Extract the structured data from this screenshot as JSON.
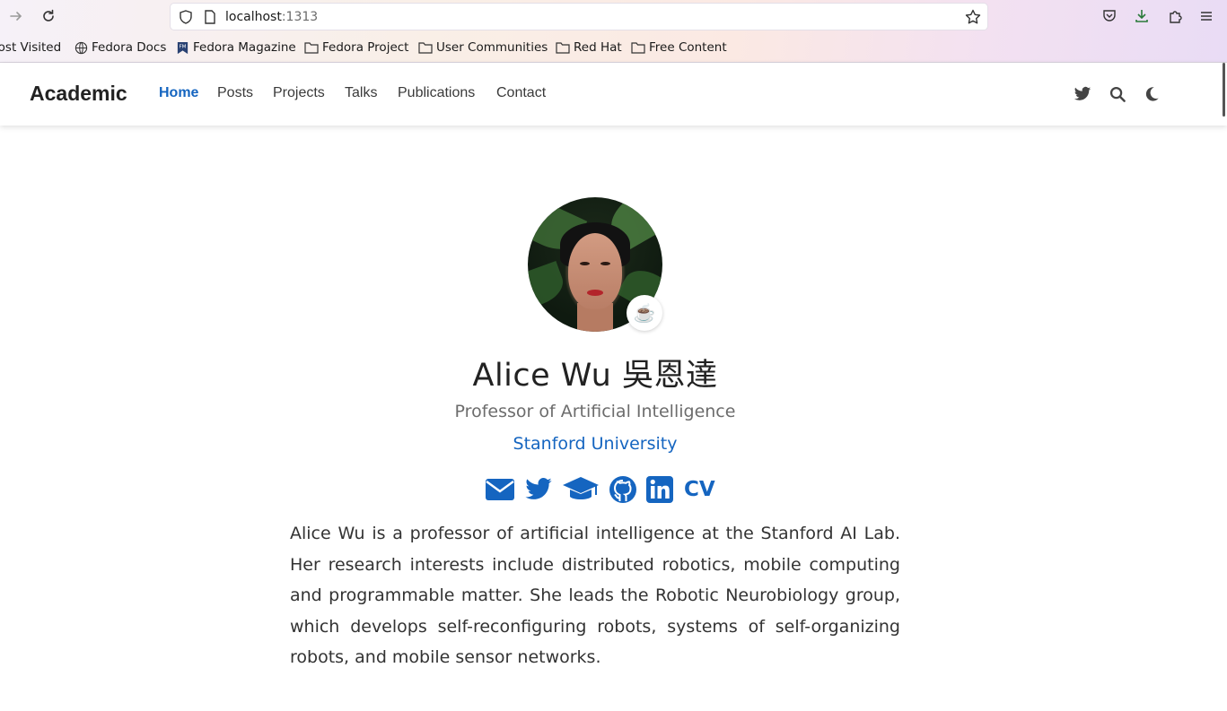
{
  "browser": {
    "url_host": "localhost",
    "url_port": ":1313",
    "bookmarks": [
      {
        "label": "Most Visited",
        "icon": "globe-icon"
      },
      {
        "label": "Fedora Docs",
        "icon": "globe-icon"
      },
      {
        "label": "Fedora Magazine",
        "icon": "fedora-magazine-icon"
      },
      {
        "label": "Fedora Project",
        "icon": "folder-icon"
      },
      {
        "label": "User Communities",
        "icon": "folder-icon"
      },
      {
        "label": "Red Hat",
        "icon": "folder-icon"
      },
      {
        "label": "Free Content",
        "icon": "folder-icon"
      }
    ]
  },
  "site": {
    "brand": "Academic",
    "nav": [
      "Home",
      "Posts",
      "Projects",
      "Talks",
      "Publications",
      "Contact"
    ],
    "active_nav": "Home",
    "accent_color": "#1565c0"
  },
  "profile": {
    "status_emoji": "☕️",
    "name": "Alice Wu 吳恩達",
    "role": "Professor of Artificial Intelligence",
    "organization": "Stanford University",
    "social": [
      "envelope-icon",
      "twitter-icon",
      "graduation-cap-icon",
      "github-icon",
      "linkedin-icon"
    ],
    "cv_label": "CV",
    "bio": "Alice Wu is a professor of artificial intelligence at the Stanford AI Lab. Her research interests include distributed robotics, mobile computing and programmable matter. She leads the Robotic Neurobiology group, which develops self-reconfiguring robots, systems of self-organizing robots, and mobile sensor networks."
  }
}
